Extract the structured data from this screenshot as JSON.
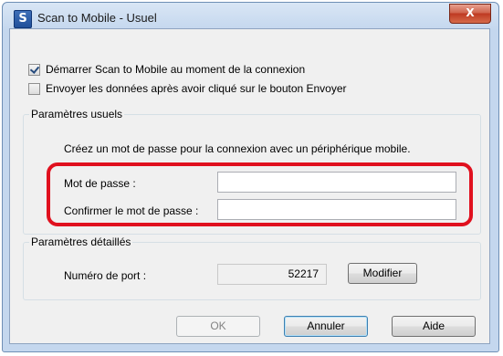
{
  "window": {
    "title": "Scan to Mobile - Usuel",
    "close_glyph": "X"
  },
  "checkboxes": [
    {
      "label": "Démarrer Scan to Mobile au moment de la connexion",
      "checked": true
    },
    {
      "label": "Envoyer les données après avoir cliqué sur le bouton Envoyer",
      "checked": false
    }
  ],
  "parametres_usuels": {
    "legend": "Paramètres usuels",
    "description": "Créez un mot de passe pour la connexion avec un périphérique mobile.",
    "password_label": "Mot de passe :",
    "password_value": "",
    "confirm_label": "Confirmer le mot de passe :",
    "confirm_value": ""
  },
  "parametres_detailles": {
    "legend": "Paramètres détaillés",
    "port_label": "Numéro de port :",
    "port_value": "52217",
    "modify_button": "Modifier"
  },
  "buttons": {
    "ok": "OK",
    "cancel": "Annuler",
    "help": "Aide"
  },
  "colors": {
    "highlight": "#e0101e",
    "titlebar": "#c4d7ee",
    "client": "#f0f0f0"
  },
  "icons": {
    "app": "scansnap-app-icon",
    "close": "close-icon",
    "check": "checkmark-icon"
  }
}
